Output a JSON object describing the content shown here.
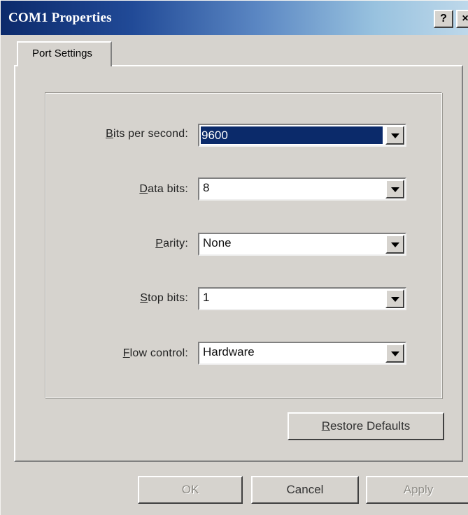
{
  "window": {
    "title": "COM1 Properties",
    "help_label": "?",
    "close_label": "×"
  },
  "tabs": [
    {
      "label": "Port Settings",
      "active": true
    }
  ],
  "settings": {
    "bits_per_second": {
      "mnemonic": "B",
      "label_rest": "its per second:",
      "value": "9600"
    },
    "data_bits": {
      "mnemonic": "D",
      "label_rest": "ata bits:",
      "value": "8"
    },
    "parity": {
      "mnemonic": "P",
      "label_rest": "arity:",
      "value": "None"
    },
    "stop_bits": {
      "mnemonic": "S",
      "label_rest": "top bits:",
      "value": "1"
    },
    "flow_control": {
      "mnemonic": "F",
      "label_rest": "low control:",
      "value": "Hardware"
    }
  },
  "restore_defaults": {
    "mnemonic": "R",
    "label_rest": "estore Defaults"
  },
  "footer": {
    "ok_label": "OK",
    "cancel_label": "Cancel",
    "apply_label": "Apply"
  },
  "colors": {
    "face": "#d6d3ce",
    "selection": "#0b2a6a",
    "title_gradient_start": "#0c2a6b",
    "title_gradient_end": "#bed8ea"
  }
}
